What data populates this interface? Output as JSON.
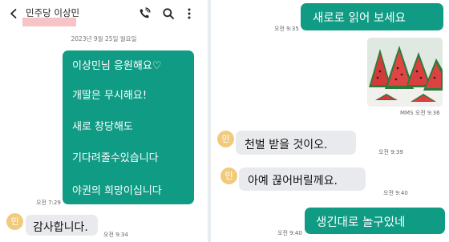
{
  "left": {
    "header": {
      "back_icon": "back-arrow-icon",
      "contact_name": "민주당 이상민",
      "redacted_color": "#f6c3c7",
      "icons": [
        "call-icon",
        "search-icon",
        "more-vert-icon"
      ]
    },
    "date_divider": "2023년 9월 25일 월요일",
    "sent_message": {
      "lines": [
        "이상민님 응원해요♡",
        "개딸은 무시해요!",
        "새로 창당해도",
        "기다려줄수있습니다",
        "야권의 희망이십니다"
      ],
      "time": "오전 7:29"
    },
    "reply": {
      "avatar_label": "민",
      "text": "감사합니다.",
      "time": "오전 9:34"
    }
  },
  "right": {
    "messages": [
      {
        "id": "sent-1",
        "text": "새로로 읽어 보세요",
        "time": "오전 9:35"
      },
      {
        "id": "mms-1",
        "image": "watermelon-slices",
        "meta": "MMS 오전 9:36"
      },
      {
        "id": "recv-1",
        "avatar_label": "민",
        "text": "천벌 받을 것이오.",
        "time": "오전 9:39"
      },
      {
        "id": "recv-2",
        "avatar_label": "민",
        "text": "아예 끊어버릴께요.",
        "time": "오전 9:40"
      },
      {
        "id": "sent-2",
        "text": "생긴대로 놀구있네",
        "time": "오전 9:40"
      }
    ]
  },
  "colors": {
    "sent_bubble": "#109b84",
    "received_bubble": "#e9eaee",
    "avatar": "#f2ca7b"
  }
}
